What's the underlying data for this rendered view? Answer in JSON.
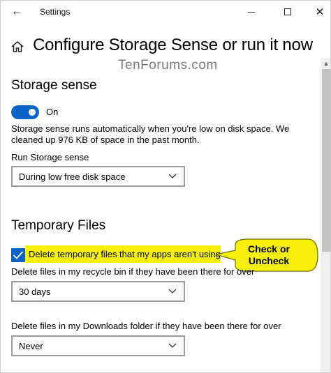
{
  "window": {
    "title": "Settings",
    "back_icon": "back-arrow-icon",
    "minimize_icon": "minimize-icon",
    "maximize_icon": "maximize-icon",
    "close_icon": "close-icon",
    "back_glyph": "←",
    "close_glyph": "✕"
  },
  "header": {
    "home_icon": "home-icon",
    "title": "Configure Storage Sense or run it now"
  },
  "watermark": "TenForums.com",
  "storage_sense": {
    "heading": "Storage sense",
    "toggle_state": "On",
    "description": "Storage sense runs automatically when you're low on disk space. We cleaned up 976 KB of space in the past month.",
    "run_label": "Run Storage sense",
    "run_value": "During low free disk space"
  },
  "temporary_files": {
    "heading": "Temporary Files",
    "delete_temp_label": "Delete temporary files that my apps aren't using",
    "delete_temp_checked": true,
    "recycle_label": "Delete files in my recycle bin if they have been there for over",
    "recycle_value": "30 days",
    "downloads_label": "Delete files in my Downloads folder if they have been there for over",
    "downloads_value": "Never"
  },
  "callout": {
    "text_line1": "Check or",
    "text_line2": "Uncheck"
  },
  "colors": {
    "accent": "#0a64c8",
    "highlight": "#f6f00a",
    "callout_fill": "#f6f00a"
  }
}
